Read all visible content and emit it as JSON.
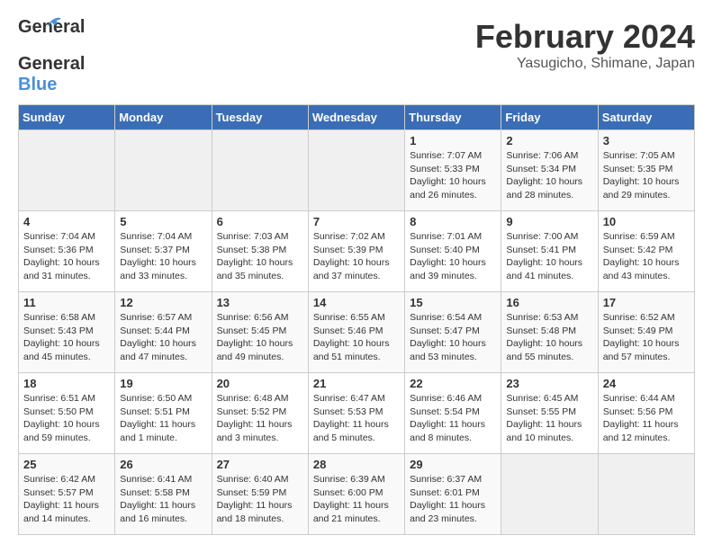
{
  "logo": {
    "line1": "General",
    "line2": "Blue"
  },
  "title": "February 2024",
  "location": "Yasugicho, Shimane, Japan",
  "days_of_week": [
    "Sunday",
    "Monday",
    "Tuesday",
    "Wednesday",
    "Thursday",
    "Friday",
    "Saturday"
  ],
  "weeks": [
    [
      {
        "day": "",
        "info": ""
      },
      {
        "day": "",
        "info": ""
      },
      {
        "day": "",
        "info": ""
      },
      {
        "day": "",
        "info": ""
      },
      {
        "day": "1",
        "info": "Sunrise: 7:07 AM\nSunset: 5:33 PM\nDaylight: 10 hours\nand 26 minutes."
      },
      {
        "day": "2",
        "info": "Sunrise: 7:06 AM\nSunset: 5:34 PM\nDaylight: 10 hours\nand 28 minutes."
      },
      {
        "day": "3",
        "info": "Sunrise: 7:05 AM\nSunset: 5:35 PM\nDaylight: 10 hours\nand 29 minutes."
      }
    ],
    [
      {
        "day": "4",
        "info": "Sunrise: 7:04 AM\nSunset: 5:36 PM\nDaylight: 10 hours\nand 31 minutes."
      },
      {
        "day": "5",
        "info": "Sunrise: 7:04 AM\nSunset: 5:37 PM\nDaylight: 10 hours\nand 33 minutes."
      },
      {
        "day": "6",
        "info": "Sunrise: 7:03 AM\nSunset: 5:38 PM\nDaylight: 10 hours\nand 35 minutes."
      },
      {
        "day": "7",
        "info": "Sunrise: 7:02 AM\nSunset: 5:39 PM\nDaylight: 10 hours\nand 37 minutes."
      },
      {
        "day": "8",
        "info": "Sunrise: 7:01 AM\nSunset: 5:40 PM\nDaylight: 10 hours\nand 39 minutes."
      },
      {
        "day": "9",
        "info": "Sunrise: 7:00 AM\nSunset: 5:41 PM\nDaylight: 10 hours\nand 41 minutes."
      },
      {
        "day": "10",
        "info": "Sunrise: 6:59 AM\nSunset: 5:42 PM\nDaylight: 10 hours\nand 43 minutes."
      }
    ],
    [
      {
        "day": "11",
        "info": "Sunrise: 6:58 AM\nSunset: 5:43 PM\nDaylight: 10 hours\nand 45 minutes."
      },
      {
        "day": "12",
        "info": "Sunrise: 6:57 AM\nSunset: 5:44 PM\nDaylight: 10 hours\nand 47 minutes."
      },
      {
        "day": "13",
        "info": "Sunrise: 6:56 AM\nSunset: 5:45 PM\nDaylight: 10 hours\nand 49 minutes."
      },
      {
        "day": "14",
        "info": "Sunrise: 6:55 AM\nSunset: 5:46 PM\nDaylight: 10 hours\nand 51 minutes."
      },
      {
        "day": "15",
        "info": "Sunrise: 6:54 AM\nSunset: 5:47 PM\nDaylight: 10 hours\nand 53 minutes."
      },
      {
        "day": "16",
        "info": "Sunrise: 6:53 AM\nSunset: 5:48 PM\nDaylight: 10 hours\nand 55 minutes."
      },
      {
        "day": "17",
        "info": "Sunrise: 6:52 AM\nSunset: 5:49 PM\nDaylight: 10 hours\nand 57 minutes."
      }
    ],
    [
      {
        "day": "18",
        "info": "Sunrise: 6:51 AM\nSunset: 5:50 PM\nDaylight: 10 hours\nand 59 minutes."
      },
      {
        "day": "19",
        "info": "Sunrise: 6:50 AM\nSunset: 5:51 PM\nDaylight: 11 hours\nand 1 minute."
      },
      {
        "day": "20",
        "info": "Sunrise: 6:48 AM\nSunset: 5:52 PM\nDaylight: 11 hours\nand 3 minutes."
      },
      {
        "day": "21",
        "info": "Sunrise: 6:47 AM\nSunset: 5:53 PM\nDaylight: 11 hours\nand 5 minutes."
      },
      {
        "day": "22",
        "info": "Sunrise: 6:46 AM\nSunset: 5:54 PM\nDaylight: 11 hours\nand 8 minutes."
      },
      {
        "day": "23",
        "info": "Sunrise: 6:45 AM\nSunset: 5:55 PM\nDaylight: 11 hours\nand 10 minutes."
      },
      {
        "day": "24",
        "info": "Sunrise: 6:44 AM\nSunset: 5:56 PM\nDaylight: 11 hours\nand 12 minutes."
      }
    ],
    [
      {
        "day": "25",
        "info": "Sunrise: 6:42 AM\nSunset: 5:57 PM\nDaylight: 11 hours\nand 14 minutes."
      },
      {
        "day": "26",
        "info": "Sunrise: 6:41 AM\nSunset: 5:58 PM\nDaylight: 11 hours\nand 16 minutes."
      },
      {
        "day": "27",
        "info": "Sunrise: 6:40 AM\nSunset: 5:59 PM\nDaylight: 11 hours\nand 18 minutes."
      },
      {
        "day": "28",
        "info": "Sunrise: 6:39 AM\nSunset: 6:00 PM\nDaylight: 11 hours\nand 21 minutes."
      },
      {
        "day": "29",
        "info": "Sunrise: 6:37 AM\nSunset: 6:01 PM\nDaylight: 11 hours\nand 23 minutes."
      },
      {
        "day": "",
        "info": ""
      },
      {
        "day": "",
        "info": ""
      }
    ]
  ]
}
